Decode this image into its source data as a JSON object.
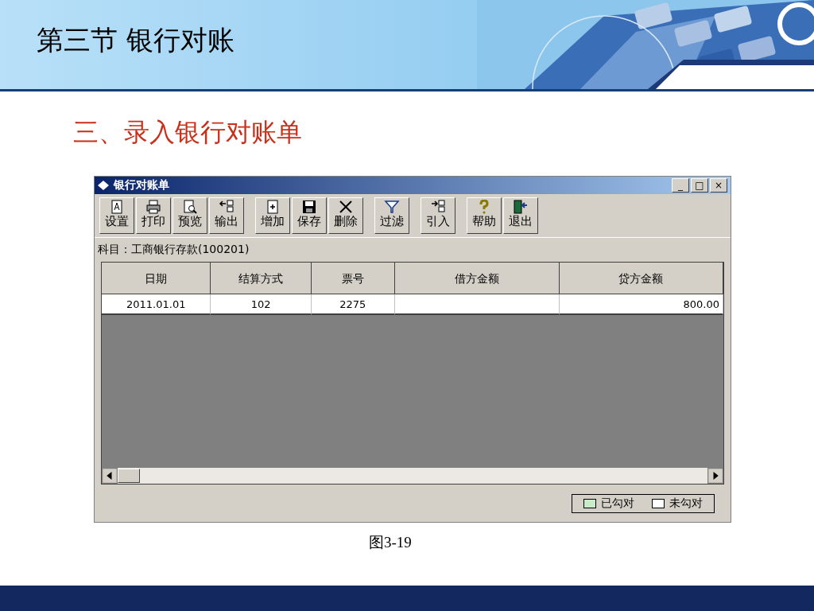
{
  "slide": {
    "title": "第三节  银行对账",
    "heading": "三、录入银行对账单",
    "caption": "图3-19"
  },
  "window": {
    "title": "银行对账单",
    "controls": [
      "_",
      "□",
      "×"
    ],
    "toolbar": [
      [
        {
          "label": "设置"
        },
        {
          "label": "打印"
        },
        {
          "label": "预览"
        },
        {
          "label": "输出"
        }
      ],
      [
        {
          "label": "增加"
        },
        {
          "label": "保存"
        },
        {
          "label": "删除"
        }
      ],
      [
        {
          "label": "过滤"
        }
      ],
      [
        {
          "label": "引入"
        }
      ],
      [
        {
          "label": "帮助"
        },
        {
          "label": "退出"
        }
      ]
    ],
    "account": "科目：工商银行存款(100201)",
    "table": {
      "columns": [
        "日期",
        "结算方式",
        "票号",
        "借方金额",
        "贷方金额"
      ],
      "rows": [
        [
          "2011.01.01",
          "102",
          "2275",
          "",
          "800.00"
        ]
      ]
    },
    "legend": [
      {
        "label": "已勾对",
        "color": "#c8ecc8"
      },
      {
        "label": "未勾对",
        "color": "#ffffff"
      }
    ]
  }
}
